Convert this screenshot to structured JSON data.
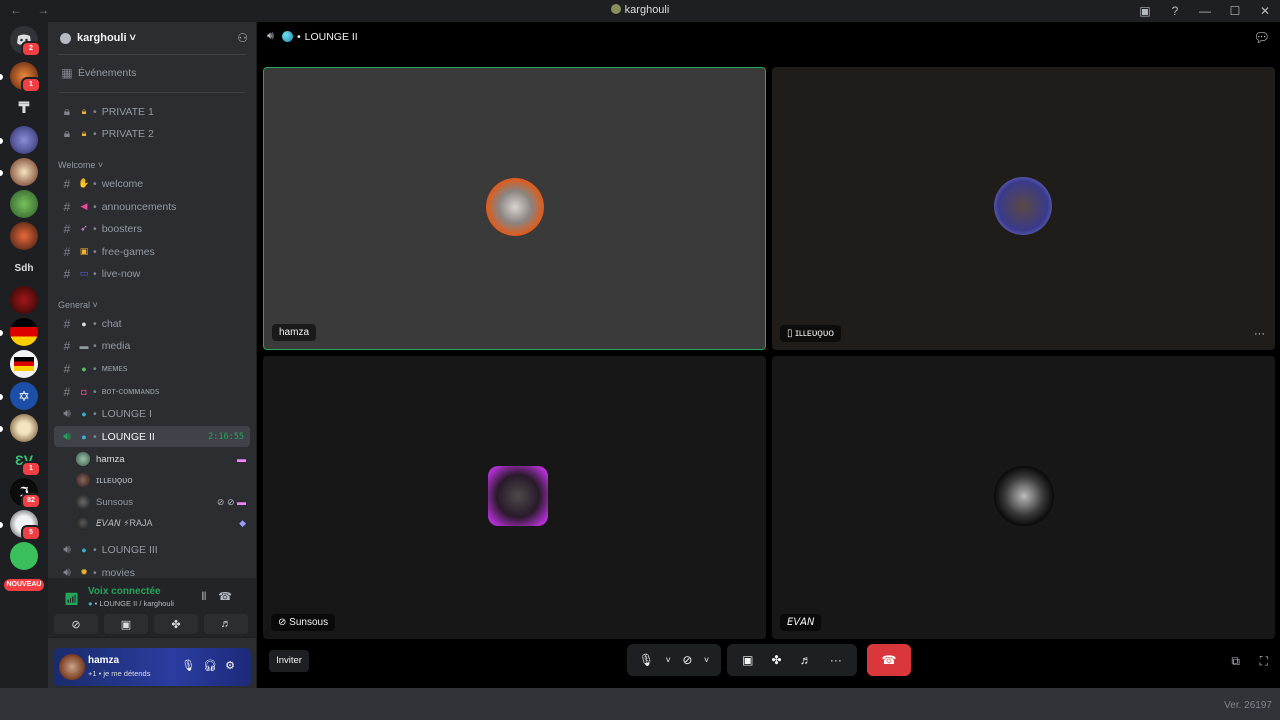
{
  "window": {
    "title": "karghouli",
    "nav": "← →",
    "controls": [
      "▣",
      "?",
      "—",
      "☐",
      "✕"
    ]
  },
  "rail": {
    "badges": [
      "2",
      "1",
      "1",
      "1",
      "82",
      "5"
    ],
    "sdh_label": "Sdh",
    "nouveau_label": "NOUVEAU"
  },
  "sidebar": {
    "server_name": "karghouli ˅",
    "events": "Événements",
    "private": [
      "PRIVATE 1",
      "PRIVATE 2"
    ],
    "welcome_category": "Welcome ˅",
    "welcome_channels": [
      "welcome",
      "announcements",
      "boosters",
      "free-games",
      "live-now"
    ],
    "general_category": "General ˅",
    "general_channels": [
      "chat",
      "media",
      "ᴍᴇᴍᴇꜱ",
      "ʙᴏᴛ-ᴄᴏᴍᴍᴀɴᴅꜱ",
      "LOUNGE I"
    ],
    "active_channel": "LOUNGE II",
    "active_timer": "2:16:55",
    "members": [
      "hamza",
      "ɪʟʟᴇᴜǫᴜᴏ",
      "Sunsous",
      "𝘌𝘝𝘈𝘕 ⚡RAJA"
    ],
    "after_channels": [
      "LOUNGE III",
      "movies"
    ]
  },
  "voice_panel": {
    "title": "Voix connectée",
    "subtitle": "LOUNGE II / karghouli"
  },
  "user_panel": {
    "name": "hamza",
    "status": "+1 • je me détends"
  },
  "call": {
    "header": "LOUNGE II",
    "tiles": [
      {
        "label": "hamza"
      },
      {
        "label": "ɪʟʟᴇᴜǫᴜᴏ"
      },
      {
        "label": "Sunsous"
      },
      {
        "label": "𝘌𝘝𝘈𝘕"
      }
    ],
    "invite_label": "Inviter"
  },
  "footer": {
    "version": "Ver. 26197"
  }
}
